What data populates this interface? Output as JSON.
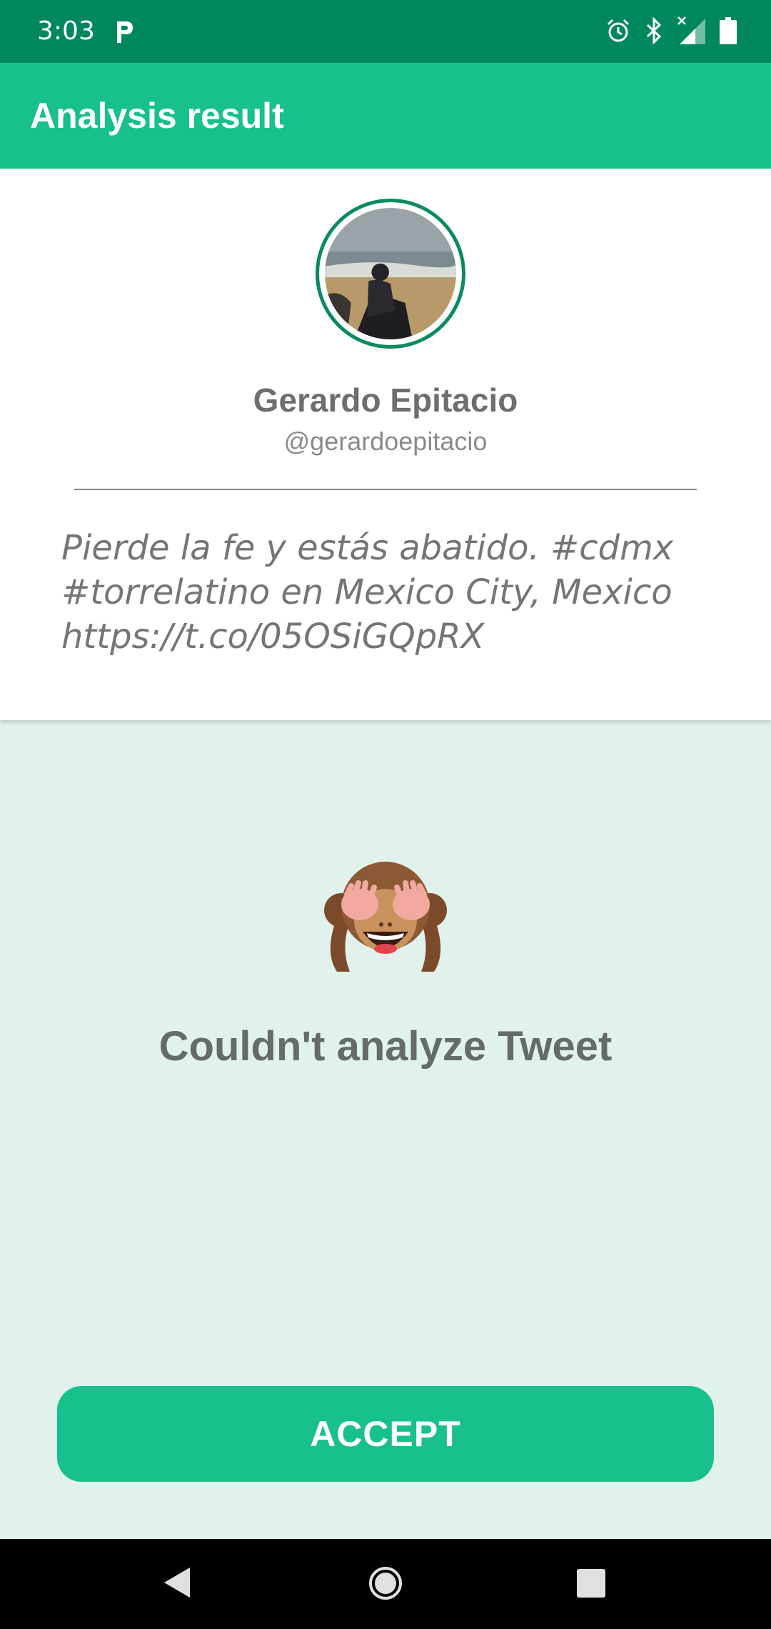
{
  "status_bar": {
    "time": "3:03",
    "notification_icons": [
      "p-app-icon"
    ],
    "system_icons": [
      "alarm-icon",
      "bluetooth-icon",
      "cell-signal-no-service-icon",
      "battery-icon"
    ]
  },
  "app_bar": {
    "title": "Analysis result"
  },
  "profile": {
    "name": "Gerardo Epitacio",
    "handle": "@gerardoepitacio",
    "tweet": "Pierde la fe y estás abatido. #cdmx #torrelatino en Mexico City, Mexico https://t.co/05OSiGQpRX"
  },
  "result": {
    "emoji": "see-no-evil-monkey-icon",
    "message": "Couldn't analyze Tweet"
  },
  "actions": {
    "accept_label": "ACCEPT"
  },
  "nav_bar": {
    "icons": [
      "back-icon",
      "home-icon",
      "recents-icon"
    ]
  },
  "colors": {
    "status_bar": "#00875e",
    "app_bar": "#17c08c",
    "background": "#e1f2ec",
    "accent": "#17c08c",
    "avatar_ring": "#0a8a60"
  }
}
